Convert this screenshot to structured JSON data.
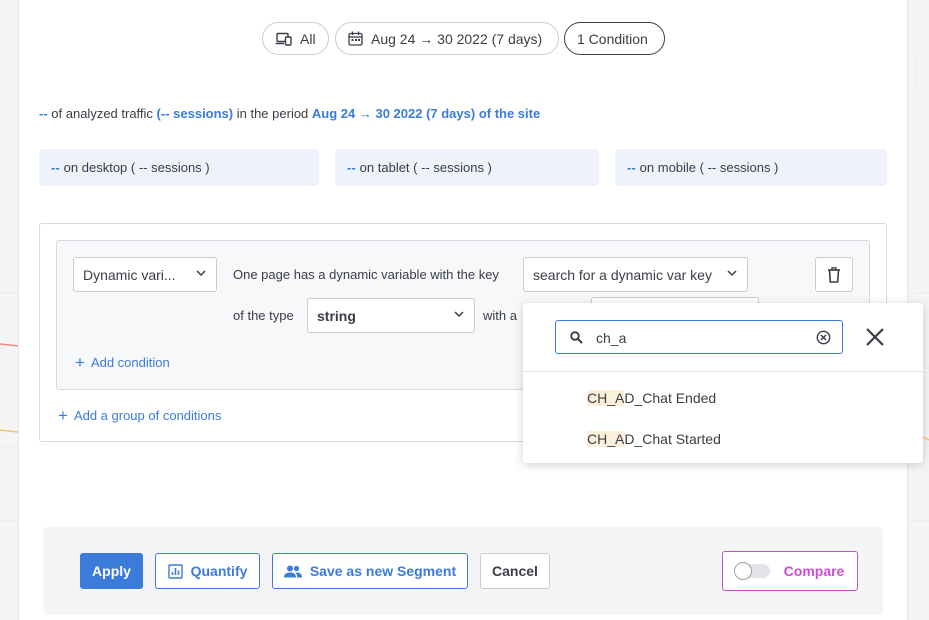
{
  "filters": {
    "device_label": "All",
    "date_label": "Aug 24 → 30 2022 (7 days)",
    "condition_label": "1 Condition"
  },
  "summary": {
    "prefix": "--",
    "text1": " of analyzed traffic ",
    "sessions": "(-- sessions)",
    "text2": " in the period ",
    "period": "Aug 24 → 30 2022 (7 days) of the site"
  },
  "devices": {
    "desktop": {
      "value": "--",
      "text": "on desktop ( -- sessions )"
    },
    "tablet": {
      "value": "--",
      "text": "on tablet ( -- sessions )"
    },
    "mobile": {
      "value": "--",
      "text": "on mobile ( -- sessions )"
    }
  },
  "condition": {
    "type_select": "Dynamic vari...",
    "sentence1": "One page has a dynamic variable with the key",
    "key_select": "search for a dynamic var key",
    "sentence2": "of the type",
    "type_value": "string",
    "sentence3": "with a",
    "add_condition": "Add condition",
    "add_group": "Add a group of conditions"
  },
  "popup": {
    "search_value": "ch_a",
    "options": [
      {
        "match": "CH_A",
        "rest": "D_Chat Ended"
      },
      {
        "match": "CH_A",
        "rest": "D_Chat Started"
      }
    ]
  },
  "footer": {
    "apply": "Apply",
    "quantify": "Quantify",
    "save_segment": "Save as new Segment",
    "cancel": "Cancel",
    "compare": "Compare"
  },
  "colors": {
    "accent": "#3b7bd9",
    "compare": "#c84fd1",
    "highlight": "#fdf0da"
  }
}
